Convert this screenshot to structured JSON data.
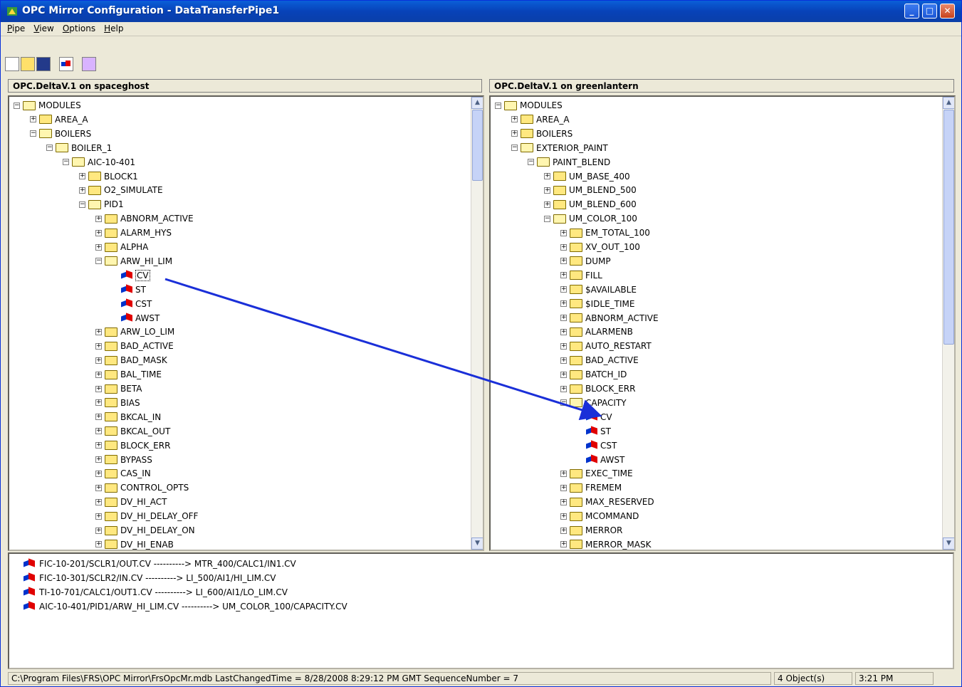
{
  "window": {
    "title": "OPC Mirror Configuration - DataTransferPipe1"
  },
  "menu": [
    "Pipe",
    "View",
    "Options",
    "Help"
  ],
  "toolbar": [
    "new-icon",
    "open-icon",
    "save-icon",
    "connect-icon",
    "settings-icon"
  ],
  "left_pane": {
    "header": "OPC.DeltaV.1 on spaceghost",
    "rows": [
      {
        "label": "MODULES",
        "lvl": 0,
        "kind": "open"
      },
      {
        "label": "AREA_A",
        "lvl": 1,
        "kind": "closed"
      },
      {
        "label": "BOILERS",
        "lvl": 1,
        "kind": "open"
      },
      {
        "label": "BOILER_1",
        "lvl": 2,
        "kind": "open"
      },
      {
        "label": "AIC-10-401",
        "lvl": 3,
        "kind": "open"
      },
      {
        "label": "BLOCK1",
        "lvl": 4,
        "kind": "closed"
      },
      {
        "label": "O2_SIMULATE",
        "lvl": 4,
        "kind": "closed"
      },
      {
        "label": "PID1",
        "lvl": 4,
        "kind": "open"
      },
      {
        "label": "ABNORM_ACTIVE",
        "lvl": 5,
        "kind": "closed"
      },
      {
        "label": "ALARM_HYS",
        "lvl": 5,
        "kind": "closed"
      },
      {
        "label": "ALPHA",
        "lvl": 5,
        "kind": "closed"
      },
      {
        "label": "ARW_HI_LIM",
        "lvl": 5,
        "kind": "open"
      },
      {
        "label": "CV",
        "lvl": 6,
        "kind": "tag",
        "sel": true
      },
      {
        "label": "ST",
        "lvl": 6,
        "kind": "tag"
      },
      {
        "label": "CST",
        "lvl": 6,
        "kind": "tag"
      },
      {
        "label": "AWST",
        "lvl": 6,
        "kind": "tag"
      },
      {
        "label": "ARW_LO_LIM",
        "lvl": 5,
        "kind": "closed"
      },
      {
        "label": "BAD_ACTIVE",
        "lvl": 5,
        "kind": "closed"
      },
      {
        "label": "BAD_MASK",
        "lvl": 5,
        "kind": "closed"
      },
      {
        "label": "BAL_TIME",
        "lvl": 5,
        "kind": "closed"
      },
      {
        "label": "BETA",
        "lvl": 5,
        "kind": "closed"
      },
      {
        "label": "BIAS",
        "lvl": 5,
        "kind": "closed"
      },
      {
        "label": "BKCAL_IN",
        "lvl": 5,
        "kind": "closed"
      },
      {
        "label": "BKCAL_OUT",
        "lvl": 5,
        "kind": "closed"
      },
      {
        "label": "BLOCK_ERR",
        "lvl": 5,
        "kind": "closed"
      },
      {
        "label": "BYPASS",
        "lvl": 5,
        "kind": "closed"
      },
      {
        "label": "CAS_IN",
        "lvl": 5,
        "kind": "closed"
      },
      {
        "label": "CONTROL_OPTS",
        "lvl": 5,
        "kind": "closed"
      },
      {
        "label": "DV_HI_ACT",
        "lvl": 5,
        "kind": "closed"
      },
      {
        "label": "DV_HI_DELAY_OFF",
        "lvl": 5,
        "kind": "closed"
      },
      {
        "label": "DV_HI_DELAY_ON",
        "lvl": 5,
        "kind": "closed"
      },
      {
        "label": "DV_HI_ENAB",
        "lvl": 5,
        "kind": "closed"
      }
    ]
  },
  "right_pane": {
    "header": "OPC.DeltaV.1 on greenlantern",
    "rows": [
      {
        "label": "MODULES",
        "lvl": 0,
        "kind": "open"
      },
      {
        "label": "AREA_A",
        "lvl": 1,
        "kind": "closed"
      },
      {
        "label": "BOILERS",
        "lvl": 1,
        "kind": "closed"
      },
      {
        "label": "EXTERIOR_PAINT",
        "lvl": 1,
        "kind": "open"
      },
      {
        "label": "PAINT_BLEND",
        "lvl": 2,
        "kind": "open"
      },
      {
        "label": "UM_BASE_400",
        "lvl": 3,
        "kind": "closed"
      },
      {
        "label": "UM_BLEND_500",
        "lvl": 3,
        "kind": "closed"
      },
      {
        "label": "UM_BLEND_600",
        "lvl": 3,
        "kind": "closed"
      },
      {
        "label": "UM_COLOR_100",
        "lvl": 3,
        "kind": "open"
      },
      {
        "label": "EM_TOTAL_100",
        "lvl": 4,
        "kind": "closed"
      },
      {
        "label": "XV_OUT_100",
        "lvl": 4,
        "kind": "closed"
      },
      {
        "label": "DUMP",
        "lvl": 4,
        "kind": "closed"
      },
      {
        "label": "FILL",
        "lvl": 4,
        "kind": "closed"
      },
      {
        "label": "$AVAILABLE",
        "lvl": 4,
        "kind": "closed"
      },
      {
        "label": "$IDLE_TIME",
        "lvl": 4,
        "kind": "closed"
      },
      {
        "label": "ABNORM_ACTIVE",
        "lvl": 4,
        "kind": "closed"
      },
      {
        "label": "ALARMENB",
        "lvl": 4,
        "kind": "closed"
      },
      {
        "label": "AUTO_RESTART",
        "lvl": 4,
        "kind": "closed"
      },
      {
        "label": "BAD_ACTIVE",
        "lvl": 4,
        "kind": "closed"
      },
      {
        "label": "BATCH_ID",
        "lvl": 4,
        "kind": "closed"
      },
      {
        "label": "BLOCK_ERR",
        "lvl": 4,
        "kind": "closed"
      },
      {
        "label": "CAPACITY",
        "lvl": 4,
        "kind": "open"
      },
      {
        "label": "CV",
        "lvl": 5,
        "kind": "tag"
      },
      {
        "label": "ST",
        "lvl": 5,
        "kind": "tag"
      },
      {
        "label": "CST",
        "lvl": 5,
        "kind": "tag"
      },
      {
        "label": "AWST",
        "lvl": 5,
        "kind": "tag"
      },
      {
        "label": "EXEC_TIME",
        "lvl": 4,
        "kind": "closed"
      },
      {
        "label": "FREMEM",
        "lvl": 4,
        "kind": "closed"
      },
      {
        "label": "MAX_RESERVED",
        "lvl": 4,
        "kind": "closed"
      },
      {
        "label": "MCOMMAND",
        "lvl": 4,
        "kind": "closed"
      },
      {
        "label": "MERROR",
        "lvl": 4,
        "kind": "closed"
      },
      {
        "label": "MERROR_MASK",
        "lvl": 4,
        "kind": "closed"
      }
    ]
  },
  "mappings": [
    "FIC-10-201/SCLR1/OUT.CV  ----------> MTR_400/CALC1/IN1.CV",
    "FIC-10-301/SCLR2/IN.CV  ----------> LI_500/AI1/HI_LIM.CV",
    "TI-10-701/CALC1/OUT1.CV  ----------> LI_600/AI1/LO_LIM.CV",
    "AIC-10-401/PID1/ARW_HI_LIM.CV  ----------> UM_COLOR_100/CAPACITY.CV"
  ],
  "status": {
    "path": "C:\\Program Files\\FRS\\OPC Mirror\\FrsOpcMr.mdb   LastChangedTime = 8/28/2008 8:29:12 PM GMT   SequenceNumber = 7",
    "objects": "4 Object(s)",
    "time": "3:21 PM"
  },
  "accent": "#0a5fd8",
  "arrow_color": "#1a2fd8"
}
